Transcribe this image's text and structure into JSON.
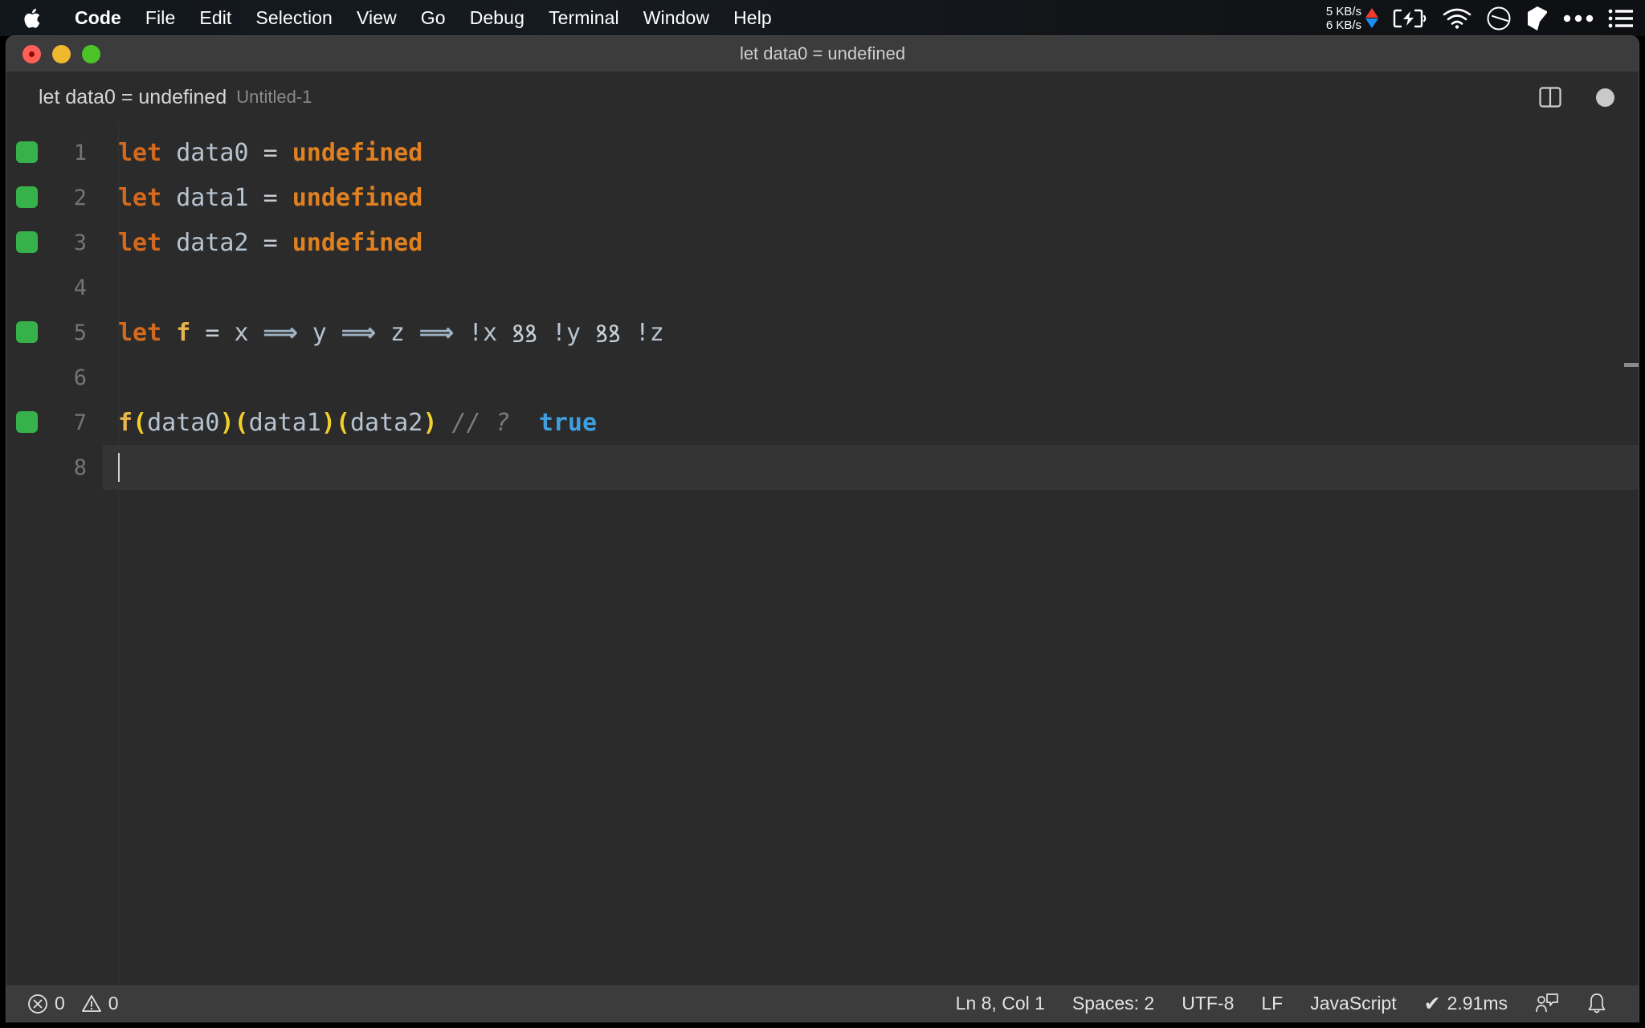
{
  "menubar": {
    "apple_icon": "apple-logo",
    "items": [
      {
        "label": "Code",
        "bold": true
      },
      {
        "label": "File"
      },
      {
        "label": "Edit"
      },
      {
        "label": "Selection"
      },
      {
        "label": "View"
      },
      {
        "label": "Go"
      },
      {
        "label": "Debug"
      },
      {
        "label": "Terminal"
      },
      {
        "label": "Window"
      },
      {
        "label": "Help"
      }
    ],
    "tray": {
      "upload_speed": "5 KB/s",
      "download_speed": "6 KB/s",
      "up_arrow_color": "#f03b2e",
      "down_arrow_color": "#1b8ef0",
      "icons": [
        "battery-charging-icon",
        "wifi-icon",
        "clock-gauge-icon",
        "cube-icon",
        "ellipsis-icon",
        "control-center-list-icon"
      ]
    }
  },
  "window": {
    "title": "let data0 = undefined",
    "traffic_lights": [
      "close-button",
      "minimize-button",
      "maximize-button"
    ]
  },
  "tab": {
    "title": "let data0 = undefined",
    "subtitle": "Untitled-1",
    "actions": [
      "split-editor-icon",
      "unsaved-indicator"
    ]
  },
  "editor": {
    "lines": [
      {
        "number": "1",
        "marker": true,
        "active": false,
        "tokens": [
          {
            "t": "let",
            "c": "keyword"
          },
          {
            "t": " ",
            "c": "plain"
          },
          {
            "t": "data0",
            "c": "var"
          },
          {
            "t": " ",
            "c": "plain"
          },
          {
            "t": "=",
            "c": "op"
          },
          {
            "t": " ",
            "c": "plain"
          },
          {
            "t": "undefined",
            "c": "undef"
          }
        ]
      },
      {
        "number": "2",
        "marker": true,
        "active": false,
        "tokens": [
          {
            "t": "let",
            "c": "keyword"
          },
          {
            "t": " ",
            "c": "plain"
          },
          {
            "t": "data1",
            "c": "var"
          },
          {
            "t": " ",
            "c": "plain"
          },
          {
            "t": "=",
            "c": "op"
          },
          {
            "t": " ",
            "c": "plain"
          },
          {
            "t": "undefined",
            "c": "undef"
          }
        ]
      },
      {
        "number": "3",
        "marker": true,
        "active": false,
        "tokens": [
          {
            "t": "let",
            "c": "keyword"
          },
          {
            "t": " ",
            "c": "plain"
          },
          {
            "t": "data2",
            "c": "var"
          },
          {
            "t": " ",
            "c": "plain"
          },
          {
            "t": "=",
            "c": "op"
          },
          {
            "t": " ",
            "c": "plain"
          },
          {
            "t": "undefined",
            "c": "undef"
          }
        ]
      },
      {
        "number": "4",
        "marker": false,
        "active": false,
        "tokens": []
      },
      {
        "number": "5",
        "marker": true,
        "active": false,
        "tokens": [
          {
            "t": "let",
            "c": "keyword"
          },
          {
            "t": " ",
            "c": "plain"
          },
          {
            "t": "f",
            "c": "fn"
          },
          {
            "t": " ",
            "c": "plain"
          },
          {
            "t": "=",
            "c": "op"
          },
          {
            "t": " ",
            "c": "plain"
          },
          {
            "t": "x",
            "c": "var"
          },
          {
            "t": " ",
            "c": "plain"
          },
          {
            "t": "⟹",
            "c": "arrow"
          },
          {
            "t": " ",
            "c": "plain"
          },
          {
            "t": "y",
            "c": "var"
          },
          {
            "t": " ",
            "c": "plain"
          },
          {
            "t": "⟹",
            "c": "arrow"
          },
          {
            "t": " ",
            "c": "plain"
          },
          {
            "t": "z",
            "c": "var"
          },
          {
            "t": " ",
            "c": "plain"
          },
          {
            "t": "⟹",
            "c": "arrow"
          },
          {
            "t": " ",
            "c": "plain"
          },
          {
            "t": "!x",
            "c": "var"
          },
          {
            "t": " ",
            "c": "plain"
          },
          {
            "t": "ꝸꝸ",
            "c": "op"
          },
          {
            "t": " ",
            "c": "plain"
          },
          {
            "t": "!y",
            "c": "var"
          },
          {
            "t": " ",
            "c": "plain"
          },
          {
            "t": "ꝸꝸ",
            "c": "op"
          },
          {
            "t": " ",
            "c": "plain"
          },
          {
            "t": "!z",
            "c": "var"
          }
        ]
      },
      {
        "number": "6",
        "marker": false,
        "active": false,
        "tokens": []
      },
      {
        "number": "7",
        "marker": true,
        "active": false,
        "tokens": [
          {
            "t": "f",
            "c": "fn"
          },
          {
            "t": "(",
            "c": "paren"
          },
          {
            "t": "data0",
            "c": "var"
          },
          {
            "t": ")",
            "c": "paren"
          },
          {
            "t": "(",
            "c": "paren"
          },
          {
            "t": "data1",
            "c": "var"
          },
          {
            "t": ")",
            "c": "paren"
          },
          {
            "t": "(",
            "c": "paren"
          },
          {
            "t": "data2",
            "c": "var"
          },
          {
            "t": ")",
            "c": "paren"
          },
          {
            "t": " ",
            "c": "plain"
          },
          {
            "t": "// ?",
            "c": "comment"
          },
          {
            "t": "  ",
            "c": "plain"
          },
          {
            "t": "true",
            "c": "value"
          }
        ]
      },
      {
        "number": "8",
        "marker": false,
        "active": true,
        "tokens": []
      }
    ],
    "raw_code": "let data0 = undefined\nlet data1 = undefined\nlet data2 = undefined\n\nlet f = x => y => z => !x && !y && !z\n\nf(data0)(data1)(data2) // ?  true\n"
  },
  "statusbar": {
    "errors_count": "0",
    "warnings_count": "0",
    "cursor_position": "Ln 8, Col 1",
    "indentation": "Spaces: 2",
    "encoding": "UTF-8",
    "eol": "LF",
    "language": "JavaScript",
    "run_time": "2.91ms",
    "run_check": "✔",
    "icons": [
      "error-icon",
      "warning-icon",
      "feedback-icon",
      "bell-icon"
    ]
  },
  "colors": {
    "menubar_bg": "#12171c",
    "window_chrome": "#3c3c3c",
    "editor_bg": "#2b2b2b",
    "active_line_bg": "#343434",
    "keyword": "#d2691e",
    "undefined_value": "#e08020",
    "identifier": "#b7c4d1",
    "function": "#e8b44c",
    "paren": "#f2d02c",
    "comment": "#7c7c7c",
    "inline_value": "#3f9fe0",
    "gutter_marker": "#37b24a"
  }
}
